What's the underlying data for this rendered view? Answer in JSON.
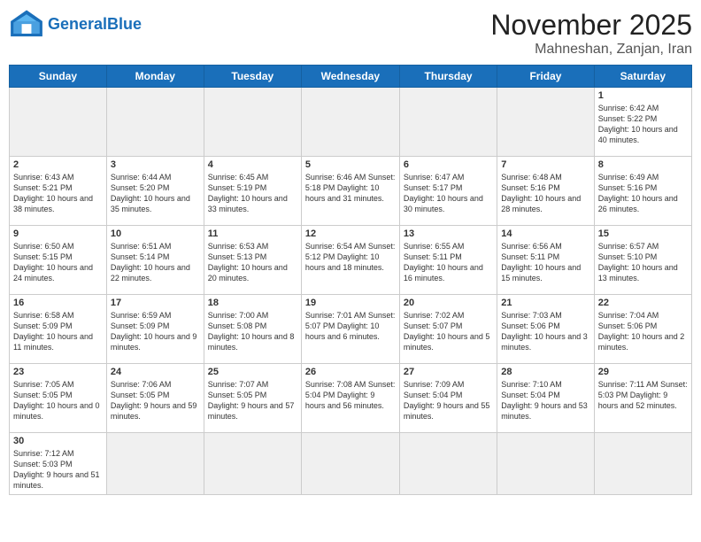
{
  "header": {
    "logo_general": "General",
    "logo_blue": "Blue",
    "month_title": "November 2025",
    "subtitle": "Mahneshan, Zanjan, Iran"
  },
  "days_of_week": [
    "Sunday",
    "Monday",
    "Tuesday",
    "Wednesday",
    "Thursday",
    "Friday",
    "Saturday"
  ],
  "weeks": [
    [
      {
        "day": "",
        "info": ""
      },
      {
        "day": "",
        "info": ""
      },
      {
        "day": "",
        "info": ""
      },
      {
        "day": "",
        "info": ""
      },
      {
        "day": "",
        "info": ""
      },
      {
        "day": "",
        "info": ""
      },
      {
        "day": "1",
        "info": "Sunrise: 6:42 AM\nSunset: 5:22 PM\nDaylight: 10 hours and 40 minutes."
      }
    ],
    [
      {
        "day": "2",
        "info": "Sunrise: 6:43 AM\nSunset: 5:21 PM\nDaylight: 10 hours and 38 minutes."
      },
      {
        "day": "3",
        "info": "Sunrise: 6:44 AM\nSunset: 5:20 PM\nDaylight: 10 hours and 35 minutes."
      },
      {
        "day": "4",
        "info": "Sunrise: 6:45 AM\nSunset: 5:19 PM\nDaylight: 10 hours and 33 minutes."
      },
      {
        "day": "5",
        "info": "Sunrise: 6:46 AM\nSunset: 5:18 PM\nDaylight: 10 hours and 31 minutes."
      },
      {
        "day": "6",
        "info": "Sunrise: 6:47 AM\nSunset: 5:17 PM\nDaylight: 10 hours and 30 minutes."
      },
      {
        "day": "7",
        "info": "Sunrise: 6:48 AM\nSunset: 5:16 PM\nDaylight: 10 hours and 28 minutes."
      },
      {
        "day": "8",
        "info": "Sunrise: 6:49 AM\nSunset: 5:16 PM\nDaylight: 10 hours and 26 minutes."
      }
    ],
    [
      {
        "day": "9",
        "info": "Sunrise: 6:50 AM\nSunset: 5:15 PM\nDaylight: 10 hours and 24 minutes."
      },
      {
        "day": "10",
        "info": "Sunrise: 6:51 AM\nSunset: 5:14 PM\nDaylight: 10 hours and 22 minutes."
      },
      {
        "day": "11",
        "info": "Sunrise: 6:53 AM\nSunset: 5:13 PM\nDaylight: 10 hours and 20 minutes."
      },
      {
        "day": "12",
        "info": "Sunrise: 6:54 AM\nSunset: 5:12 PM\nDaylight: 10 hours and 18 minutes."
      },
      {
        "day": "13",
        "info": "Sunrise: 6:55 AM\nSunset: 5:11 PM\nDaylight: 10 hours and 16 minutes."
      },
      {
        "day": "14",
        "info": "Sunrise: 6:56 AM\nSunset: 5:11 PM\nDaylight: 10 hours and 15 minutes."
      },
      {
        "day": "15",
        "info": "Sunrise: 6:57 AM\nSunset: 5:10 PM\nDaylight: 10 hours and 13 minutes."
      }
    ],
    [
      {
        "day": "16",
        "info": "Sunrise: 6:58 AM\nSunset: 5:09 PM\nDaylight: 10 hours and 11 minutes."
      },
      {
        "day": "17",
        "info": "Sunrise: 6:59 AM\nSunset: 5:09 PM\nDaylight: 10 hours and 9 minutes."
      },
      {
        "day": "18",
        "info": "Sunrise: 7:00 AM\nSunset: 5:08 PM\nDaylight: 10 hours and 8 minutes."
      },
      {
        "day": "19",
        "info": "Sunrise: 7:01 AM\nSunset: 5:07 PM\nDaylight: 10 hours and 6 minutes."
      },
      {
        "day": "20",
        "info": "Sunrise: 7:02 AM\nSunset: 5:07 PM\nDaylight: 10 hours and 5 minutes."
      },
      {
        "day": "21",
        "info": "Sunrise: 7:03 AM\nSunset: 5:06 PM\nDaylight: 10 hours and 3 minutes."
      },
      {
        "day": "22",
        "info": "Sunrise: 7:04 AM\nSunset: 5:06 PM\nDaylight: 10 hours and 2 minutes."
      }
    ],
    [
      {
        "day": "23",
        "info": "Sunrise: 7:05 AM\nSunset: 5:05 PM\nDaylight: 10 hours and 0 minutes."
      },
      {
        "day": "24",
        "info": "Sunrise: 7:06 AM\nSunset: 5:05 PM\nDaylight: 9 hours and 59 minutes."
      },
      {
        "day": "25",
        "info": "Sunrise: 7:07 AM\nSunset: 5:05 PM\nDaylight: 9 hours and 57 minutes."
      },
      {
        "day": "26",
        "info": "Sunrise: 7:08 AM\nSunset: 5:04 PM\nDaylight: 9 hours and 56 minutes."
      },
      {
        "day": "27",
        "info": "Sunrise: 7:09 AM\nSunset: 5:04 PM\nDaylight: 9 hours and 55 minutes."
      },
      {
        "day": "28",
        "info": "Sunrise: 7:10 AM\nSunset: 5:04 PM\nDaylight: 9 hours and 53 minutes."
      },
      {
        "day": "29",
        "info": "Sunrise: 7:11 AM\nSunset: 5:03 PM\nDaylight: 9 hours and 52 minutes."
      }
    ],
    [
      {
        "day": "30",
        "info": "Sunrise: 7:12 AM\nSunset: 5:03 PM\nDaylight: 9 hours and 51 minutes."
      },
      {
        "day": "",
        "info": ""
      },
      {
        "day": "",
        "info": ""
      },
      {
        "day": "",
        "info": ""
      },
      {
        "day": "",
        "info": ""
      },
      {
        "day": "",
        "info": ""
      },
      {
        "day": "",
        "info": ""
      }
    ]
  ]
}
